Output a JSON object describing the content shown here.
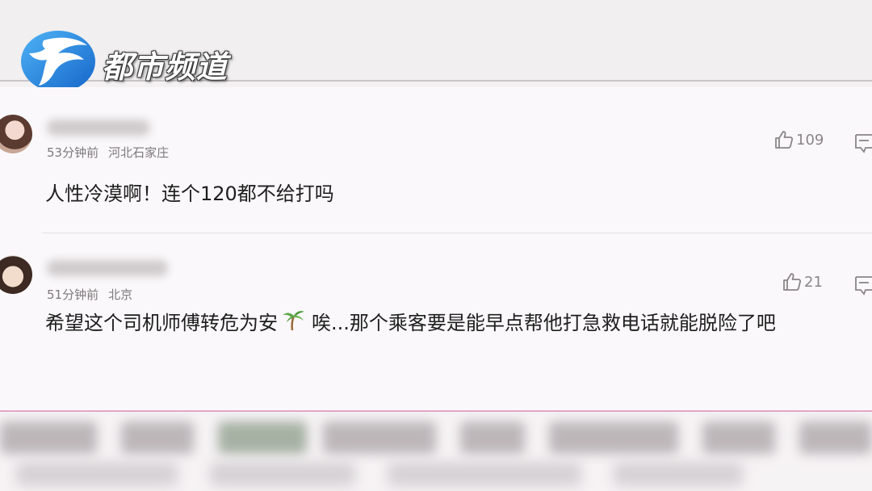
{
  "header": {
    "channel_name": "都市频道",
    "logo_icon": "station-logo-icon",
    "logo_color": "#1f7fd6"
  },
  "comments": [
    {
      "time": "53分钟前",
      "location": "河北石家庄",
      "text": "人性冷漠啊！连个120都不给打吗",
      "likes": "109"
    },
    {
      "time": "51分钟前",
      "location": "北京",
      "text_before_emoji": "希望这个司机师傅转危为安",
      "emoji_icon": "palm-tree-icon",
      "text_after_emoji": "唉...那个乘客要是能早点帮他打急救电话就能脱险了吧",
      "likes": "21"
    }
  ]
}
